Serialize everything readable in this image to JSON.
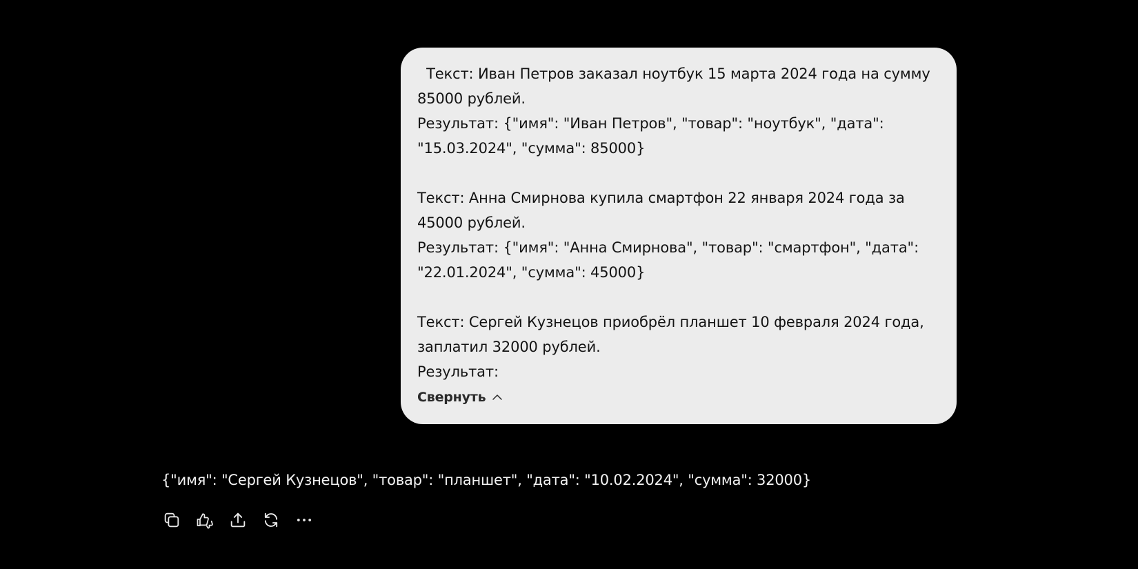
{
  "user_message": {
    "text": "  Текст: Иван Петров заказал ноутбук 15 марта 2024 года на сумму\n85000 рублей.\nРезультат: {\"имя\": \"Иван Петров\", \"товар\": \"ноутбук\", \"дата\":\n\"15.03.2024\", \"сумма\": 85000}\n\nТекст: Анна Смирнова купила смартфон 22 января 2024 года за\n45000 рублей.\nРезультат: {\"имя\": \"Анна Смирнова\", \"товар\": \"смартфон\", \"дата\":\n\"22.01.2024\", \"сумма\": 45000}\n\nТекст: Сергей Кузнецов приобрёл планшет 10 февраля 2024 года,\nзаплатил 32000 рублей.\nРезультат:",
    "collapse_label": "Свернуть",
    "collapse_icon": "chevron-up-icon"
  },
  "assistant_message": {
    "text": "{\"имя\": \"Сергей Кузнецов\", \"товар\": \"планшет\", \"дата\": \"10.02.2024\", \"сумма\": 32000}"
  },
  "actions": {
    "copy_icon": "copy-icon",
    "feedback_icon": "thumbs-up-down-icon",
    "share_icon": "share-icon",
    "regenerate_icon": "regenerate-icon",
    "more_icon": "more-icon"
  },
  "colors": {
    "background": "#000000",
    "bubble": "#ececec",
    "icon": "#e8e8e8"
  }
}
